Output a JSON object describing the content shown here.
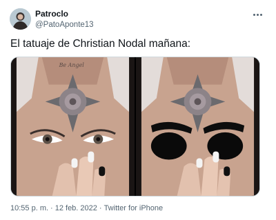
{
  "author": {
    "display_name": "Patroclo",
    "handle": "@PatoAponte13"
  },
  "tweet": {
    "text": "El tatuaje de Christian Nodal mañana:"
  },
  "meta": {
    "time": "10:55 p. m.",
    "separator": "·",
    "date": "12 feb. 2022",
    "source": "Twitter for iPhone"
  },
  "icons": {
    "more": "more-icon",
    "avatar": "avatar"
  },
  "colors": {
    "text_primary": "#0f1419",
    "text_secondary": "#536471",
    "border": "#cfd9de"
  }
}
